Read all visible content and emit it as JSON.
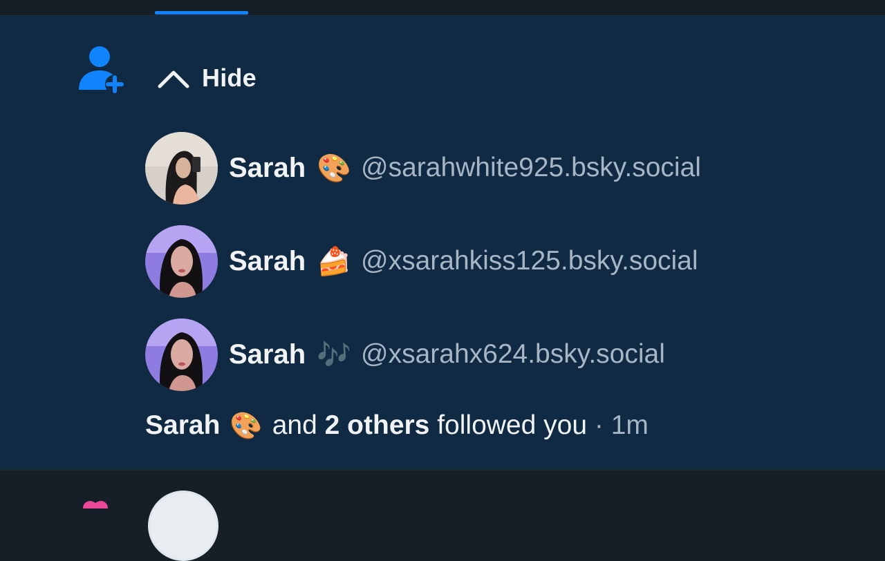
{
  "header": {
    "active_tab_color": "#1083fe"
  },
  "notification": {
    "icon": "person-plus-icon",
    "hide_label": "Hide",
    "followers": [
      {
        "name": "Sarah",
        "emoji": "🎨",
        "handle": "@sarahwhite925.bsky.social"
      },
      {
        "name": "Sarah",
        "emoji": "🍰",
        "handle": "@xsarahkiss125.bsky.social"
      },
      {
        "name": "Sarah",
        "emoji": "🎶",
        "handle": "@xsarahx624.bsky.social"
      }
    ],
    "summary": {
      "name": "Sarah",
      "emoji": "🎨",
      "and": "and",
      "others": "2 others",
      "action": "followed you",
      "sep": "·",
      "time": "1m"
    }
  },
  "colors": {
    "card_bg": "#0f2a42",
    "page_bg": "#161e27",
    "accent": "#1083fe",
    "text": "#f1f3f5",
    "muted": "#a7b6c5"
  }
}
